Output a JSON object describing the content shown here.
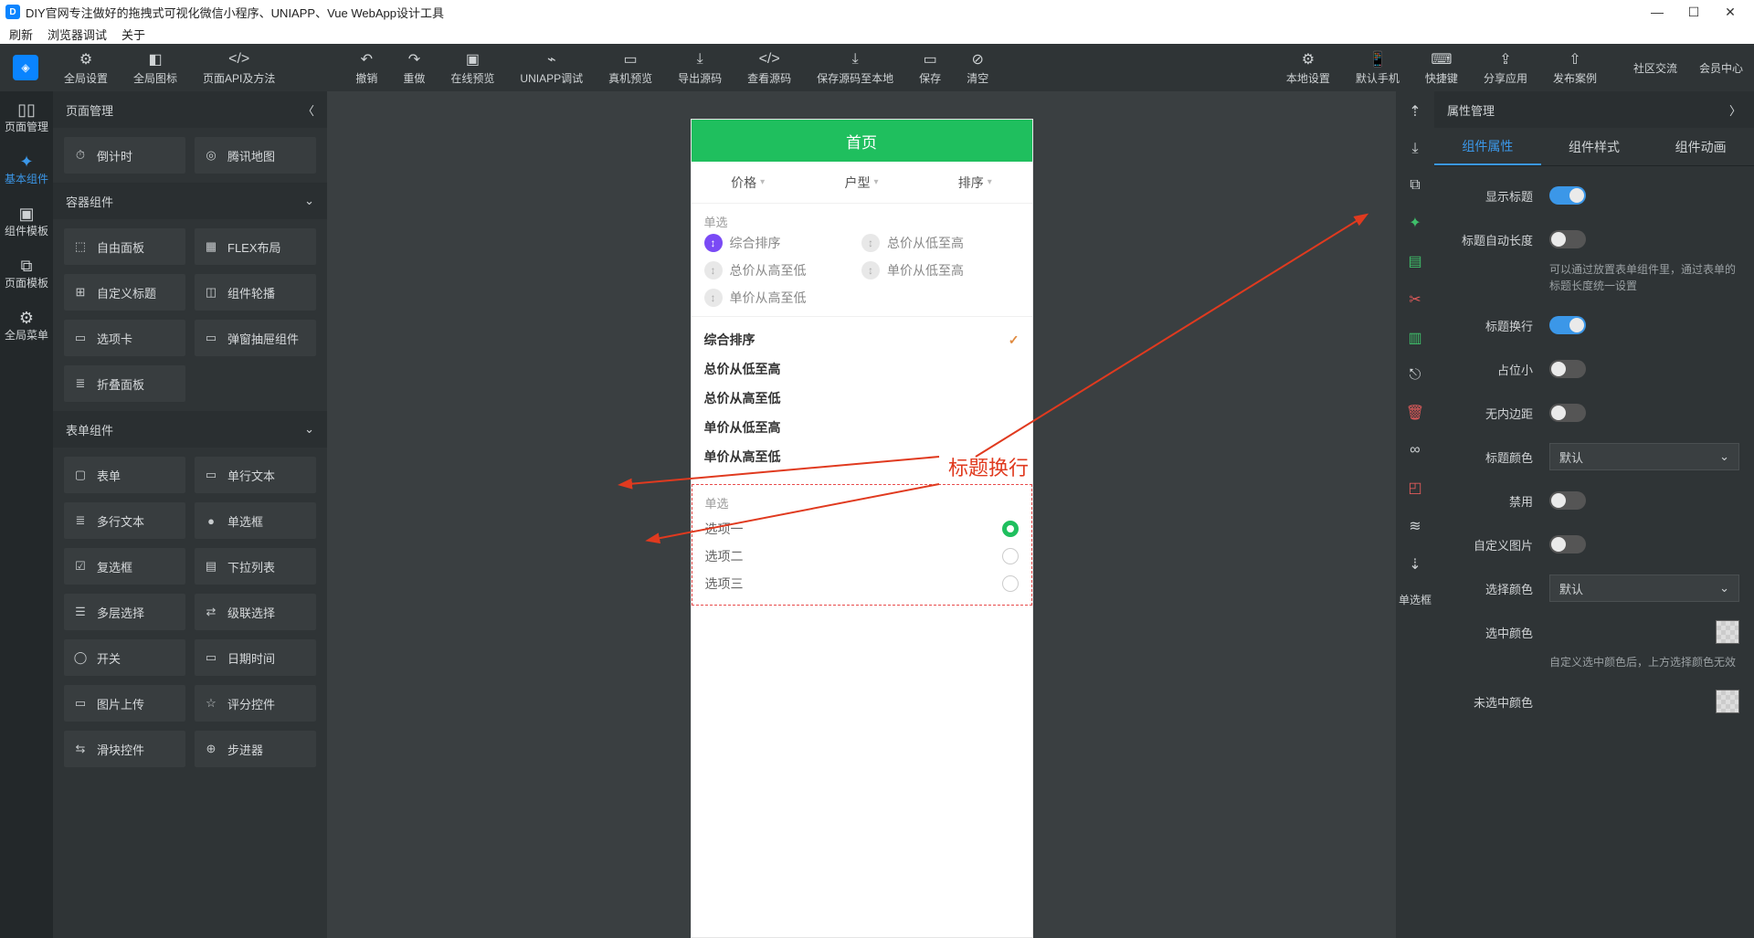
{
  "window": {
    "title": "DIY官网专注做好的拖拽式可视化微信小程序、UNIAPP、Vue WebApp设计工具"
  },
  "native_menu": [
    "刷新",
    "浏览器调试",
    "关于"
  ],
  "toolbar": {
    "left": [
      {
        "key": "global-settings",
        "label": "全局设置",
        "icon": "⚙"
      },
      {
        "key": "global-icons",
        "label": "全局图标",
        "icon": "◧"
      },
      {
        "key": "page-api",
        "label": "页面API及方法",
        "icon": "</>"
      }
    ],
    "mid": [
      {
        "key": "undo",
        "label": "撤销",
        "icon": "↶"
      },
      {
        "key": "redo",
        "label": "重做",
        "icon": "↷"
      },
      {
        "key": "online-preview",
        "label": "在线预览",
        "icon": "▣"
      },
      {
        "key": "uniapp-debug",
        "label": "UNIAPP调试",
        "icon": "⌁"
      },
      {
        "key": "real-preview",
        "label": "真机预览",
        "icon": "▭"
      },
      {
        "key": "export-src",
        "label": "导出源码",
        "icon": "⤓"
      },
      {
        "key": "view-src",
        "label": "查看源码",
        "icon": "</>"
      },
      {
        "key": "save-local",
        "label": "保存源码至本地",
        "icon": "⤓"
      },
      {
        "key": "save",
        "label": "保存",
        "icon": "▭"
      },
      {
        "key": "clear",
        "label": "清空",
        "icon": "⊘"
      }
    ],
    "right": [
      {
        "key": "local-settings",
        "label": "本地设置",
        "icon": "⚙"
      },
      {
        "key": "default-phone",
        "label": "默认手机",
        "icon": "📱"
      },
      {
        "key": "shortcut",
        "label": "快捷键",
        "icon": "⌨"
      },
      {
        "key": "share-app",
        "label": "分享应用",
        "icon": "⇪"
      },
      {
        "key": "publish-case",
        "label": "发布案例",
        "icon": "⇧"
      }
    ],
    "far_right": [
      "社区交流",
      "会员中心"
    ]
  },
  "left_rail": [
    {
      "key": "page-manage",
      "label": "页面管理"
    },
    {
      "key": "basic-comp",
      "label": "基本组件"
    },
    {
      "key": "comp-tmpl",
      "label": "组件模板"
    },
    {
      "key": "page-tmpl",
      "label": "页面模板"
    },
    {
      "key": "global-menu",
      "label": "全局菜单"
    }
  ],
  "left_panel": {
    "header": "页面管理",
    "row0": [
      "倒计时",
      "腾讯地图"
    ],
    "groups": [
      {
        "title": "容器组件",
        "items": [
          "自由面板",
          "FLEX布局",
          "自定义标题",
          "组件轮播",
          "选项卡",
          "弹窗抽屉组件",
          "折叠面板"
        ]
      },
      {
        "title": "表单组件",
        "items": [
          "表单",
          "单行文本",
          "多行文本",
          "单选框",
          "复选框",
          "下拉列表",
          "多层选择",
          "级联选择",
          "开关",
          "日期时间",
          "图片上传",
          "评分控件",
          "滑块控件",
          "步进器"
        ]
      }
    ],
    "chip_icons": [
      "⏱",
      "⊞",
      "⬚",
      "▦",
      "⊞",
      "◫",
      "▭",
      "▭",
      "≣",
      "▢",
      "▭",
      "≣",
      "●",
      "☑",
      "▤",
      "☰",
      "⇄",
      "◯",
      "▭",
      "▭",
      "☆",
      "⇆",
      "⊕"
    ]
  },
  "phone": {
    "nav_title": "首页",
    "filters": [
      "价格",
      "户型",
      "排序"
    ],
    "single_label": "单选",
    "opts": [
      "综合排序",
      "总价从低至高",
      "总价从高至低",
      "单价从低至高",
      "单价从高至低"
    ],
    "opts_grid": [
      {
        "t": "综合排序",
        "active": true
      },
      {
        "t": "总价从低至高",
        "active": false
      },
      {
        "t": "总价从高至低",
        "active": false
      },
      {
        "t": "单价从低至高",
        "active": false
      },
      {
        "t": "单价从高至低",
        "active": false
      }
    ],
    "radio_label": "单选",
    "radio_items": [
      "选项一",
      "选项二",
      "选项三"
    ]
  },
  "annotation": {
    "label": "标题换行"
  },
  "right_rail_label": "单选框",
  "props_panel": {
    "header": "属性管理",
    "tabs": [
      "组件属性",
      "组件样式",
      "组件动画"
    ],
    "rows": {
      "show_title": "显示标题",
      "title_auto_len": "标题自动长度",
      "title_auto_len_help": "可以通过放置表单组件里，通过表单的标题长度统一设置",
      "title_wrap": "标题换行",
      "small_placeholder": "占位小",
      "no_padding": "无内边距",
      "title_color": "标题颜色",
      "disabled": "禁用",
      "custom_image": "自定义图片",
      "select_color": "选择颜色",
      "selected_color": "选中颜色",
      "selected_color_help": "自定义选中颜色后，上方选择颜色无效",
      "unselected_color": "未选中颜色",
      "default": "默认"
    }
  }
}
